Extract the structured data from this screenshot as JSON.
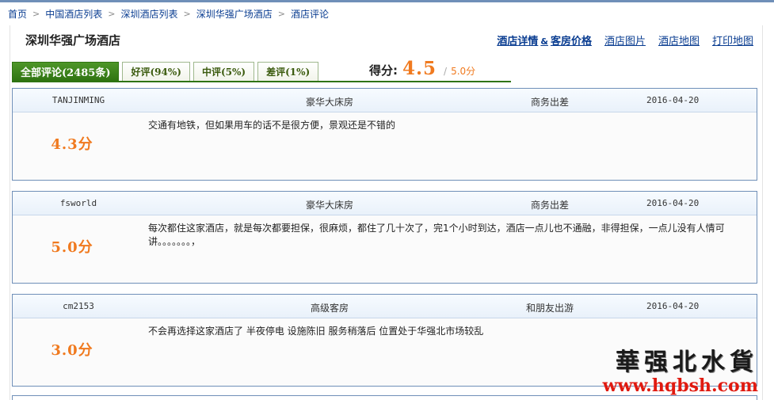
{
  "breadcrumb": {
    "items": [
      "首页",
      "中国酒店列表",
      "深圳酒店列表",
      "深圳华强广场酒店",
      "酒店评论"
    ],
    "separator": ">"
  },
  "hotel": {
    "name": "深圳华强广场酒店"
  },
  "header_links": {
    "details_part1": "酒店详情",
    "details_amp": "&",
    "details_part2": "客房价格",
    "photos": "酒店图片",
    "map": "酒店地图",
    "print_map": "打印地图"
  },
  "tabs": [
    {
      "label": "全部评论(2485条)",
      "active": true
    },
    {
      "label": "好评(94%)",
      "active": false
    },
    {
      "label": "中评(5%)",
      "active": false
    },
    {
      "label": "差评(1%)",
      "active": false
    }
  ],
  "score": {
    "label": "得分:",
    "value": "4.5",
    "slash": "/",
    "max": "5.0分"
  },
  "reviews": [
    {
      "user": "TANJINMING",
      "room": "豪华大床房",
      "trip_type": "商务出差",
      "date": "2016-04-20",
      "score": "4.3分",
      "text": "交通有地铁，但如果用车的话不是很方便，景观还是不错的"
    },
    {
      "user": "fsworld",
      "room": "豪华大床房",
      "trip_type": "商务出差",
      "date": "2016-04-20",
      "score": "5.0分",
      "text": "每次都住这家酒店，就是每次都要担保，很麻烦，都住了几十次了，完1个小时到达，酒店一点儿也不通融，非得担保，一点儿没有人情可讲。。。。。。。，"
    },
    {
      "user": "cm2153",
      "room": "高级客房",
      "trip_type": "和朋友出游",
      "date": "2016-04-20",
      "score": "3.0分",
      "text": "不会再选择这家酒店了 半夜停电 设施陈旧 服务稍落后 位置处于华强北市场较乱"
    }
  ],
  "watermark": {
    "name": "華强北水貨",
    "url": "www.hqbsh.com"
  },
  "colors": {
    "link": "#0a3d91",
    "tab_active": "#2f7412",
    "score": "#f07a1f",
    "review_border": "#6f8fb8",
    "watermark_url": "#e01a10"
  }
}
